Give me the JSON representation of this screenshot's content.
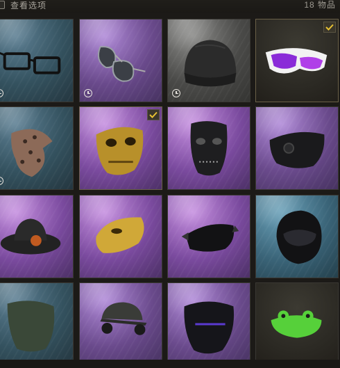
{
  "topbar": {
    "view_options_label": "查看选项",
    "item_count": "18 物品"
  },
  "colors": {
    "rarity_blue": "#3f5c6e",
    "rarity_purple": "#6a4a8c",
    "rarity_gray": "#4a4a48",
    "rarity_dark": "#2c2a24",
    "checkmark": "#e8c233"
  },
  "items": [
    {
      "name": "rectangular-glasses",
      "rarity": "blue",
      "timed": true,
      "selected": false
    },
    {
      "name": "aviator-sunglasses",
      "rarity": "purple",
      "timed": true,
      "selected": false
    },
    {
      "name": "gray-beanie",
      "rarity": "gray",
      "timed": true,
      "selected": false
    },
    {
      "name": "purple-visor-sunglasses",
      "rarity": "dark",
      "timed": false,
      "selected": true
    },
    {
      "name": "leopard-bandana",
      "rarity": "blue",
      "timed": true,
      "selected": false
    },
    {
      "name": "gold-skull-mask",
      "rarity": "purple",
      "timed": false,
      "selected": true
    },
    {
      "name": "black-stitched-mask",
      "rarity": "purple",
      "timed": false,
      "selected": false
    },
    {
      "name": "black-face-mask",
      "rarity": "purple",
      "timed": false,
      "selected": false
    },
    {
      "name": "cowboy-hat-rose",
      "rarity": "purple",
      "timed": false,
      "selected": false
    },
    {
      "name": "gold-half-mask",
      "rarity": "purple",
      "timed": false,
      "selected": false
    },
    {
      "name": "black-spiked-mask",
      "rarity": "purple",
      "timed": false,
      "selected": false
    },
    {
      "name": "black-motorcycle-helmet",
      "rarity": "blue",
      "timed": false,
      "selected": false
    },
    {
      "name": "green-face-wrap",
      "rarity": "blue",
      "timed": false,
      "selected": false
    },
    {
      "name": "cap-with-headset",
      "rarity": "purple",
      "timed": false,
      "selected": false
    },
    {
      "name": "demon-skull-mask",
      "rarity": "purple",
      "timed": false,
      "selected": false
    },
    {
      "name": "frog-mask",
      "rarity": "dark",
      "timed": false,
      "selected": false
    }
  ]
}
